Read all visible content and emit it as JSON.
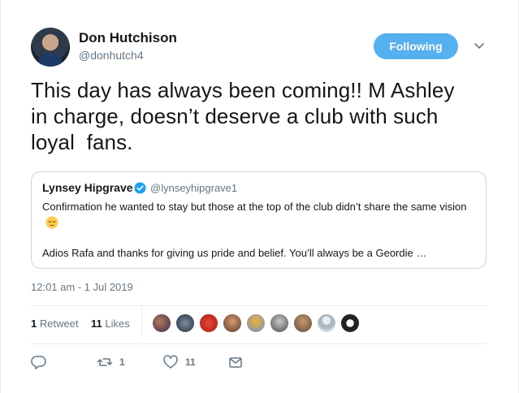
{
  "author": {
    "display_name": "Don Hutchison",
    "handle": "@donhutch4"
  },
  "follow_button": {
    "label": "Following"
  },
  "tweet": {
    "text": "This day has always been coming!! M Ashley\nin charge, doesn’t deserve a club with such\nloyal  fans."
  },
  "quoted_tweet": {
    "display_name": "Lynsey Hipgrave",
    "handle": "@lynseyhipgrave1",
    "text_line1": "Confirmation he wanted to stay but those at the top of the club didn’t share the same vision",
    "emoji": "relieved-face-icon",
    "text_line2": "Adios Rafa and thanks for giving us pride and belief. You’ll always be a Geordie …"
  },
  "timestamp": "12:01 am - 1 Jul 2019",
  "stats": {
    "retweets_count": "1",
    "retweets_label": "Retweet",
    "likes_count": "11",
    "likes_label": "Likes"
  },
  "liker_avatars_count": 9,
  "actions": {
    "reply_count": "",
    "retweet_count": "1",
    "like_count": "11"
  },
  "colors": {
    "accent": "#54b0ee",
    "muted_text": "#657786",
    "border": "#ccd6dd",
    "verified": "#1da1f2"
  }
}
